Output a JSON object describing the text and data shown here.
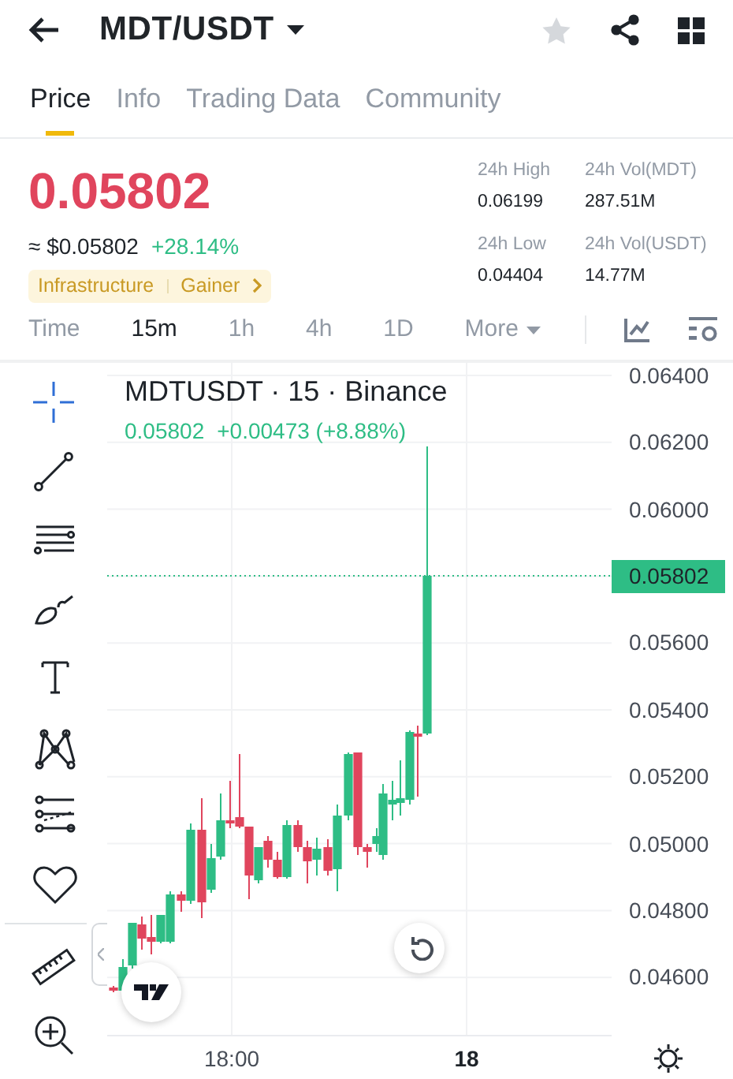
{
  "header": {
    "title": "MDT/USDT",
    "favorited": false
  },
  "tabs": [
    {
      "label": "Price",
      "selected": true
    },
    {
      "label": "Info",
      "selected": false
    },
    {
      "label": "Trading Data",
      "selected": false
    },
    {
      "label": "Community",
      "selected": false
    }
  ],
  "ticker": {
    "last_price": "0.05802",
    "fiat_price": "≈ $0.05802",
    "change": "+28.14%",
    "tags": [
      "Infrastructure",
      "Gainer"
    ],
    "stats": [
      {
        "label": "24h High",
        "value": "0.06199"
      },
      {
        "label": "24h Vol(MDT)",
        "value": "287.51M"
      },
      {
        "label": "24h Low",
        "value": "0.04404"
      },
      {
        "label": "24h Vol(USDT)",
        "value": "14.77M"
      }
    ]
  },
  "intervals": [
    {
      "label": "Time",
      "selected": false
    },
    {
      "label": "15m",
      "selected": true
    },
    {
      "label": "1h",
      "selected": false
    },
    {
      "label": "4h",
      "selected": false
    },
    {
      "label": "1D",
      "selected": false
    },
    {
      "label": "More",
      "selected": false,
      "kind": "menu"
    }
  ],
  "chart": {
    "title": "MDTUSDT · 15 · Binance",
    "quote_price": "0.05802",
    "quote_change": "+0.00473 (+8.88%)",
    "y_labels_above": [
      "0.06400",
      "0.06200",
      "0.06000"
    ],
    "last_price_label": "0.05802",
    "y_labels_below": [
      "0.05600",
      "0.05400",
      "0.05200",
      "0.05000",
      "0.04800",
      "0.04600"
    ],
    "x_labels": [
      "18:00",
      "18"
    ]
  }
}
